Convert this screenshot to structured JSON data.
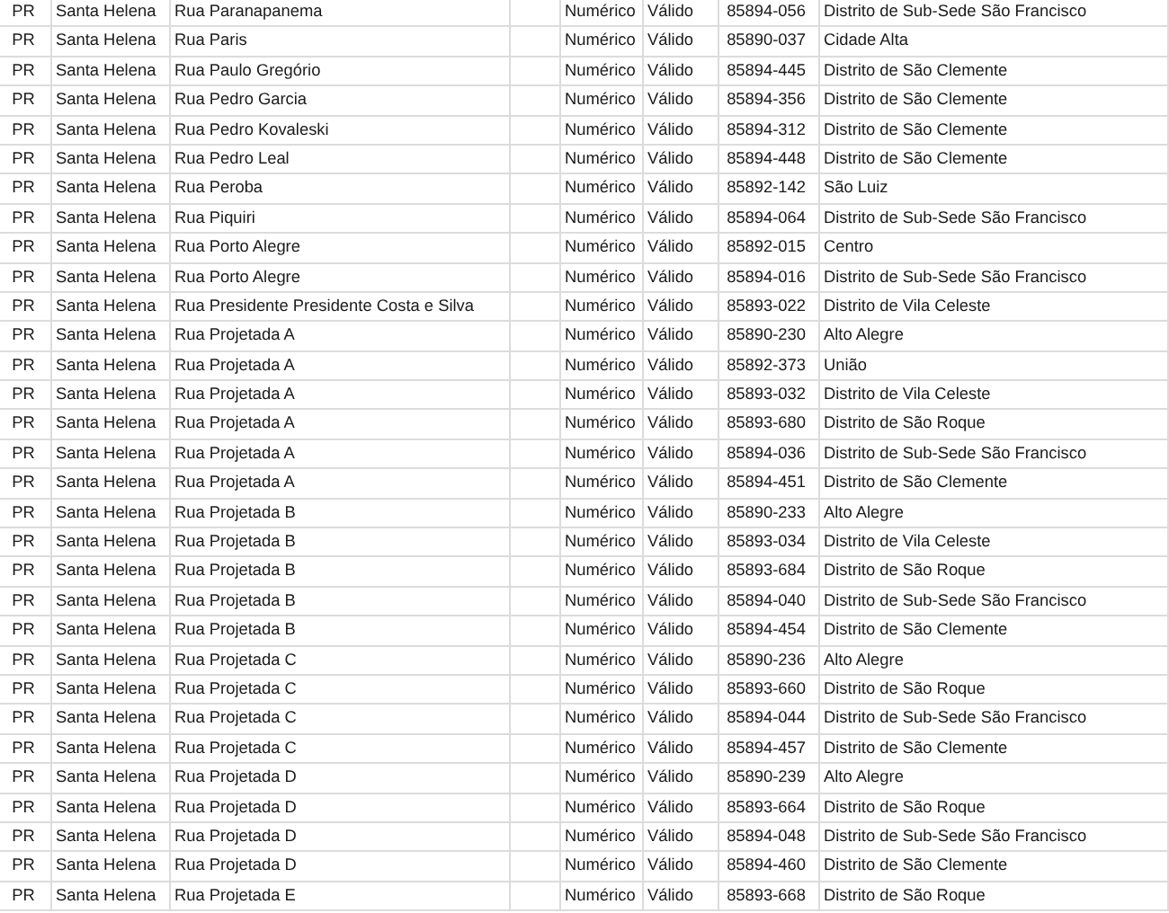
{
  "table": {
    "rows": [
      [
        "PR",
        "Santa Helena",
        "Rua Paranapanema",
        "Numérico",
        "Válido",
        "85894-056",
        "Distrito de Sub-Sede São Francisco"
      ],
      [
        "PR",
        "Santa Helena",
        "Rua Paris",
        "Numérico",
        "Válido",
        "85890-037",
        "Cidade Alta"
      ],
      [
        "PR",
        "Santa Helena",
        "Rua Paulo Gregório",
        "Numérico",
        "Válido",
        "85894-445",
        "Distrito de São Clemente"
      ],
      [
        "PR",
        "Santa Helena",
        "Rua Pedro Garcia",
        "Numérico",
        "Válido",
        "85894-356",
        "Distrito de São Clemente"
      ],
      [
        "PR",
        "Santa Helena",
        "Rua Pedro Kovaleski",
        "Numérico",
        "Válido",
        "85894-312",
        "Distrito de São Clemente"
      ],
      [
        "PR",
        "Santa Helena",
        "Rua Pedro Leal",
        "Numérico",
        "Válido",
        "85894-448",
        "Distrito de São Clemente"
      ],
      [
        "PR",
        "Santa Helena",
        "Rua Peroba",
        "Numérico",
        "Válido",
        "85892-142",
        "São Luiz"
      ],
      [
        "PR",
        "Santa Helena",
        "Rua Piquiri",
        "Numérico",
        "Válido",
        "85894-064",
        "Distrito de Sub-Sede São Francisco"
      ],
      [
        "PR",
        "Santa Helena",
        "Rua Porto Alegre",
        "Numérico",
        "Válido",
        "85892-015",
        "Centro"
      ],
      [
        "PR",
        "Santa Helena",
        "Rua Porto Alegre",
        "Numérico",
        "Válido",
        "85894-016",
        "Distrito de Sub-Sede São Francisco"
      ],
      [
        "PR",
        "Santa Helena",
        "Rua Presidente Presidente Costa e Silva",
        "Numérico",
        "Válido",
        "85893-022",
        "Distrito de Vila Celeste"
      ],
      [
        "PR",
        "Santa Helena",
        "Rua Projetada A",
        "Numérico",
        "Válido",
        "85890-230",
        "Alto Alegre"
      ],
      [
        "PR",
        "Santa Helena",
        "Rua Projetada A",
        "Numérico",
        "Válido",
        "85892-373",
        "União"
      ],
      [
        "PR",
        "Santa Helena",
        "Rua Projetada A",
        "Numérico",
        "Válido",
        "85893-032",
        "Distrito de Vila Celeste"
      ],
      [
        "PR",
        "Santa Helena",
        "Rua Projetada A",
        "Numérico",
        "Válido",
        "85893-680",
        "Distrito de São Roque"
      ],
      [
        "PR",
        "Santa Helena",
        "Rua Projetada A",
        "Numérico",
        "Válido",
        "85894-036",
        "Distrito de Sub-Sede São Francisco"
      ],
      [
        "PR",
        "Santa Helena",
        "Rua Projetada A",
        "Numérico",
        "Válido",
        "85894-451",
        "Distrito de São Clemente"
      ],
      [
        "PR",
        "Santa Helena",
        "Rua Projetada B",
        "Numérico",
        "Válido",
        "85890-233",
        "Alto Alegre"
      ],
      [
        "PR",
        "Santa Helena",
        "Rua Projetada B",
        "Numérico",
        "Válido",
        "85893-034",
        "Distrito de Vila Celeste"
      ],
      [
        "PR",
        "Santa Helena",
        "Rua Projetada B",
        "Numérico",
        "Válido",
        "85893-684",
        "Distrito de São Roque"
      ],
      [
        "PR",
        "Santa Helena",
        "Rua Projetada B",
        "Numérico",
        "Válido",
        "85894-040",
        "Distrito de Sub-Sede São Francisco"
      ],
      [
        "PR",
        "Santa Helena",
        "Rua Projetada B",
        "Numérico",
        "Válido",
        "85894-454",
        "Distrito de São Clemente"
      ],
      [
        "PR",
        "Santa Helena",
        "Rua Projetada C",
        "Numérico",
        "Válido",
        "85890-236",
        "Alto Alegre"
      ],
      [
        "PR",
        "Santa Helena",
        "Rua Projetada C",
        "Numérico",
        "Válido",
        "85893-660",
        "Distrito de São Roque"
      ],
      [
        "PR",
        "Santa Helena",
        "Rua Projetada C",
        "Numérico",
        "Válido",
        "85894-044",
        "Distrito de Sub-Sede São Francisco"
      ],
      [
        "PR",
        "Santa Helena",
        "Rua Projetada C",
        "Numérico",
        "Válido",
        "85894-457",
        "Distrito de São Clemente"
      ],
      [
        "PR",
        "Santa Helena",
        "Rua Projetada D",
        "Numérico",
        "Válido",
        "85890-239",
        "Alto Alegre"
      ],
      [
        "PR",
        "Santa Helena",
        "Rua Projetada D",
        "Numérico",
        "Válido",
        "85893-664",
        "Distrito de São Roque"
      ],
      [
        "PR",
        "Santa Helena",
        "Rua Projetada D",
        "Numérico",
        "Válido",
        "85894-048",
        "Distrito de Sub-Sede São Francisco"
      ],
      [
        "PR",
        "Santa Helena",
        "Rua Projetada D",
        "Numérico",
        "Válido",
        "85894-460",
        "Distrito de São Clemente"
      ],
      [
        "PR",
        "Santa Helena",
        "Rua Projetada E",
        "Numérico",
        "Válido",
        "85893-668",
        "Distrito de São Roque"
      ]
    ]
  }
}
